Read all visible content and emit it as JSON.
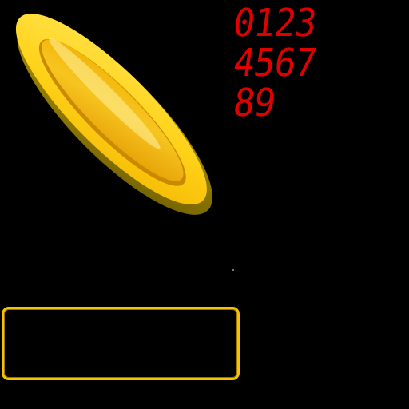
{
  "sprites": {
    "coin": {
      "icon": "gold-coin-icon",
      "colors": {
        "rim_dark": "#8f7a00",
        "face_light": "#ffe44d",
        "face_mid": "#f5b800",
        "face_inner": "#e8a200",
        "highlight": "#fff7b0"
      }
    },
    "digit_font": {
      "color": "#e00000",
      "rows": [
        "0123",
        "4567",
        "89"
      ]
    },
    "panel_frame": {
      "border_color": "#f4c400",
      "fill_color": "#000000"
    }
  }
}
